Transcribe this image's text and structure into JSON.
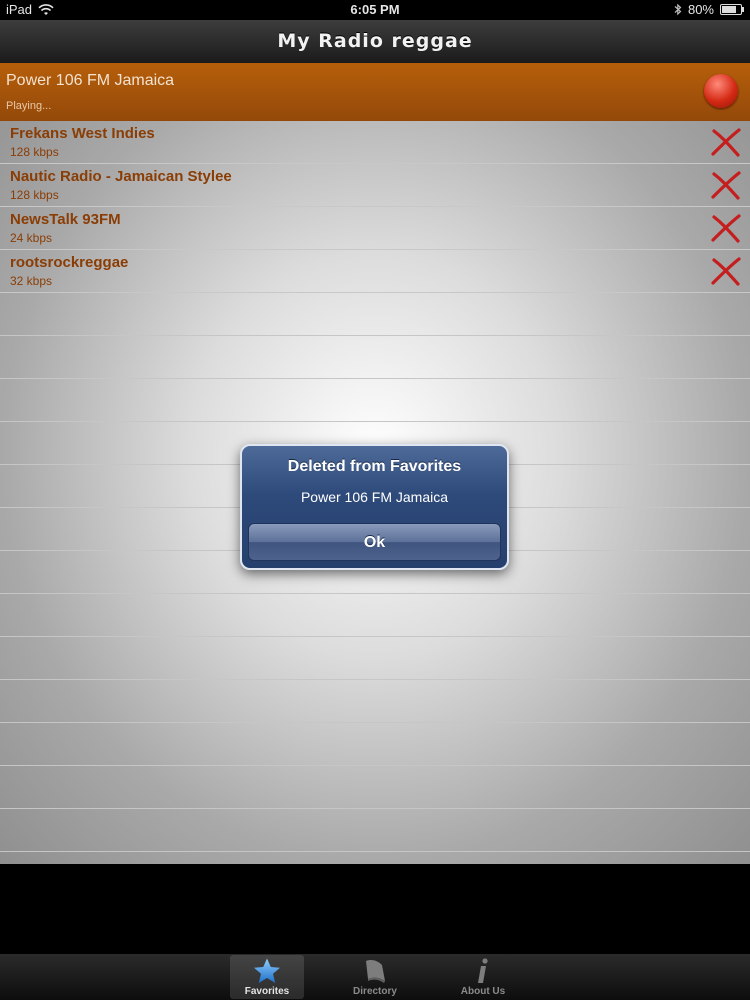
{
  "status_bar": {
    "device": "iPad",
    "time": "6:05 PM",
    "battery": "80%",
    "battery_level": 0.8
  },
  "nav": {
    "title": "My Radio reggae"
  },
  "now_playing": {
    "title": "Power 106 FM Jamaica",
    "status": "Playing..."
  },
  "favorites": [
    {
      "name": "Frekans West Indies",
      "bitrate": "128 kbps"
    },
    {
      "name": "Nautic Radio - Jamaican Stylee",
      "bitrate": "128 kbps"
    },
    {
      "name": "NewsTalk 93FM",
      "bitrate": "24 kbps"
    },
    {
      "name": "rootsrockreggae",
      "bitrate": "32 kbps"
    }
  ],
  "alert": {
    "title": "Deleted from Favorites",
    "message": "Power 106 FM Jamaica",
    "button": "Ok"
  },
  "tabs": [
    {
      "label": "Favorites",
      "icon": "star-icon",
      "active": true
    },
    {
      "label": "Directory",
      "icon": "book-icon",
      "active": false
    },
    {
      "label": "About Us",
      "icon": "info-icon",
      "active": false
    }
  ],
  "colors": {
    "accent": "#a5530a",
    "list_text": "#8a3d05",
    "alert": "#2e4a7a"
  }
}
